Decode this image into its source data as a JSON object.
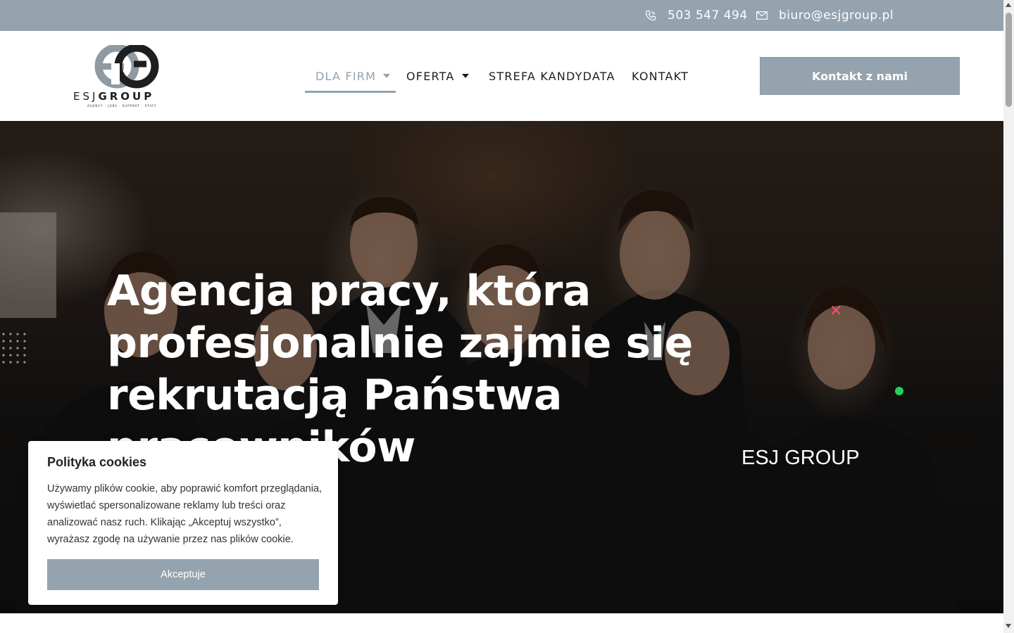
{
  "topbar": {
    "phone": "503 547 494",
    "email": "biuro@esjgroup.pl",
    "phone_icon": "phone-icon",
    "email_icon": "envelope-icon"
  },
  "logo": {
    "wordmark_light": "ESJ",
    "wordmark_bold": "GROUP",
    "tagline": "AGENCY · JOBS · SUPPORT · STAFF"
  },
  "nav": {
    "items": [
      {
        "label": "DLA FIRM",
        "has_dropdown": true,
        "active": true
      },
      {
        "label": "OFERTA",
        "has_dropdown": true,
        "active": false
      },
      {
        "label": "STREFA KANDYDATA",
        "has_dropdown": false,
        "active": false
      },
      {
        "label": "KONTAKT",
        "has_dropdown": false,
        "active": false
      }
    ]
  },
  "cta": {
    "label": "Kontakt z nami"
  },
  "hero": {
    "title": "Agencja pracy, która profesjonalnie zajmie się rekrutacją Państwa pracowników",
    "subtitle": "ESJ GROUP",
    "close_glyph": "✕"
  },
  "cookie": {
    "title": "Polityka cookies",
    "text": "Używamy plików cookie, aby poprawić komfort przeglądania, wyświetlać spersonalizowane reklamy lub treści oraz analizować nasz ruch. Klikając „Akceptuj wszystko”, wyrażasz zgodę na używanie przez nas plików cookie.",
    "button": "Akceptuje"
  },
  "colors": {
    "accent": "#94a3ad",
    "text_dark": "#1e1e1e",
    "close_x": "#ff4b6e",
    "status_dot": "#23d160"
  }
}
